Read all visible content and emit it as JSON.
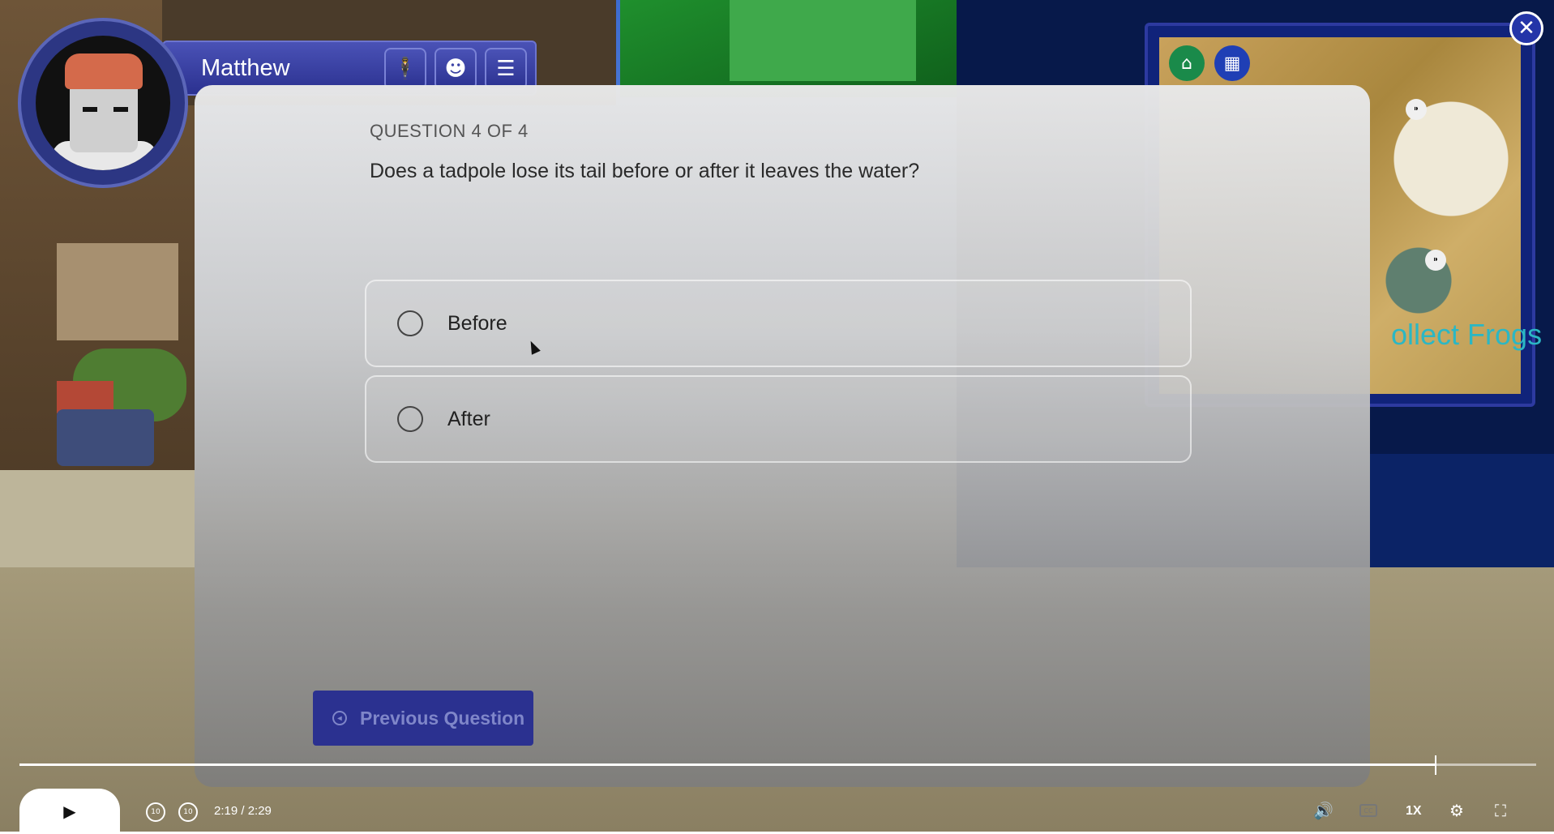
{
  "player": {
    "name": "Matthew",
    "buttons": [
      {
        "icon": "person-icon",
        "glyph": "🕴"
      },
      {
        "icon": "smiley-icon",
        "glyph": "☻"
      },
      {
        "icon": "menu-icon",
        "glyph": "☰"
      }
    ]
  },
  "minimap": {
    "label": "ollect Frogs",
    "icons": [
      {
        "icon": "school-icon",
        "glyph": "⌂",
        "color": "#1a8a4a"
      },
      {
        "icon": "city-icon",
        "glyph": "▦",
        "color": "#1f3fb5"
      }
    ],
    "markers": [
      {
        "icon": "footprints-marker-icon",
        "glyph": "⁍"
      },
      {
        "icon": "footprints-marker-icon",
        "glyph": "⁍"
      }
    ]
  },
  "close": {
    "glyph": "✕"
  },
  "quiz": {
    "counter": "QUESTION 4 OF 4",
    "question": "Does a tadpole lose its tail before or after it leaves the water?",
    "options": [
      "Before",
      "After"
    ],
    "selected": null,
    "previous_button": "Previous Question"
  },
  "player_controls": {
    "play_glyph": "▶",
    "rewind_label": "10",
    "forward_label": "10",
    "current_time": "2:19",
    "duration": "/ 2:29",
    "progress": 0.933,
    "speed": "1X",
    "volume_glyph": "🔊",
    "captions_label": "CC",
    "settings_glyph": "⚙",
    "fullscreen_glyph": "⛶"
  },
  "colors": {
    "accent": "#2b3190",
    "minimap_text": "#2bb7c4",
    "close": "#2435a8"
  }
}
